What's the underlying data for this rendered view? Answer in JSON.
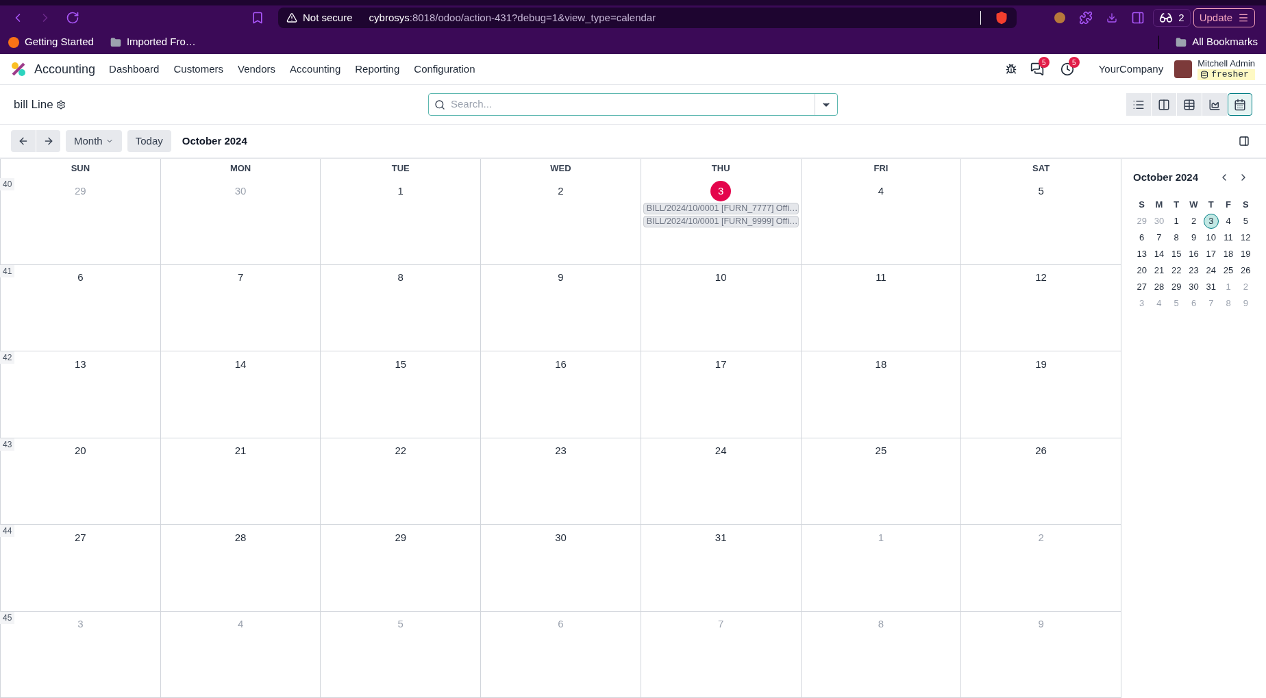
{
  "browser": {
    "security": "Not secure",
    "url_host": "cybrosys",
    "url_path": ":8018/odoo/action-431?debug=1&view_type=calendar",
    "profile_count": "2",
    "update": "Update",
    "bookmarks": [
      {
        "label": "Getting Started",
        "kind": "site"
      },
      {
        "label": "Imported Fro…",
        "kind": "folder"
      }
    ],
    "all_bookmarks": "All Bookmarks"
  },
  "navbar": {
    "app": "Accounting",
    "menu": [
      "Dashboard",
      "Customers",
      "Vendors",
      "Accounting",
      "Reporting",
      "Configuration"
    ],
    "messages_badge": "5",
    "activities_badge": "5",
    "company": "YourCompany",
    "user": "Mitchell Admin",
    "database": "fresher"
  },
  "control_panel": {
    "breadcrumb": "bill Line",
    "search_placeholder": "Search...",
    "views": [
      {
        "kind": "list",
        "selected": false
      },
      {
        "kind": "kanban",
        "selected": false
      },
      {
        "kind": "pivot",
        "selected": false
      },
      {
        "kind": "graph",
        "selected": false
      },
      {
        "kind": "calendar",
        "selected": true
      }
    ]
  },
  "toolbar": {
    "scale": "Month",
    "today": "Today",
    "title": "October 2024"
  },
  "calendar": {
    "weekdays": [
      "SUN",
      "MON",
      "TUE",
      "WED",
      "THU",
      "FRI",
      "SAT"
    ],
    "weeks": [
      {
        "number": "40",
        "days": [
          {
            "label": "29",
            "outside": true,
            "today": false
          },
          {
            "label": "30",
            "outside": true,
            "today": false
          },
          {
            "label": "1",
            "outside": false,
            "today": false
          },
          {
            "label": "2",
            "outside": false,
            "today": false
          },
          {
            "label": "3",
            "outside": false,
            "today": true,
            "events": [
              "BILL/2024/10/0001 [FURN_7777] Offi…",
              "BILL/2024/10/0001 [FURN_9999] Offi…"
            ]
          },
          {
            "label": "4",
            "outside": false,
            "today": false
          },
          {
            "label": "5",
            "outside": false,
            "today": false
          }
        ]
      },
      {
        "number": "41",
        "days": [
          {
            "label": "6",
            "outside": false,
            "today": false
          },
          {
            "label": "7",
            "outside": false,
            "today": false
          },
          {
            "label": "8",
            "outside": false,
            "today": false
          },
          {
            "label": "9",
            "outside": false,
            "today": false
          },
          {
            "label": "10",
            "outside": false,
            "today": false
          },
          {
            "label": "11",
            "outside": false,
            "today": false
          },
          {
            "label": "12",
            "outside": false,
            "today": false
          }
        ]
      },
      {
        "number": "42",
        "days": [
          {
            "label": "13",
            "outside": false,
            "today": false
          },
          {
            "label": "14",
            "outside": false,
            "today": false
          },
          {
            "label": "15",
            "outside": false,
            "today": false
          },
          {
            "label": "16",
            "outside": false,
            "today": false
          },
          {
            "label": "17",
            "outside": false,
            "today": false
          },
          {
            "label": "18",
            "outside": false,
            "today": false
          },
          {
            "label": "19",
            "outside": false,
            "today": false
          }
        ]
      },
      {
        "number": "43",
        "days": [
          {
            "label": "20",
            "outside": false,
            "today": false
          },
          {
            "label": "21",
            "outside": false,
            "today": false
          },
          {
            "label": "22",
            "outside": false,
            "today": false
          },
          {
            "label": "23",
            "outside": false,
            "today": false
          },
          {
            "label": "24",
            "outside": false,
            "today": false
          },
          {
            "label": "25",
            "outside": false,
            "today": false
          },
          {
            "label": "26",
            "outside": false,
            "today": false
          }
        ]
      },
      {
        "number": "44",
        "days": [
          {
            "label": "27",
            "outside": false,
            "today": false
          },
          {
            "label": "28",
            "outside": false,
            "today": false
          },
          {
            "label": "29",
            "outside": false,
            "today": false
          },
          {
            "label": "30",
            "outside": false,
            "today": false
          },
          {
            "label": "31",
            "outside": false,
            "today": false
          },
          {
            "label": "1",
            "outside": true,
            "today": false
          },
          {
            "label": "2",
            "outside": true,
            "today": false
          }
        ]
      },
      {
        "number": "45",
        "days": [
          {
            "label": "3",
            "outside": true,
            "today": false
          },
          {
            "label": "4",
            "outside": true,
            "today": false
          },
          {
            "label": "5",
            "outside": true,
            "today": false
          },
          {
            "label": "6",
            "outside": true,
            "today": false
          },
          {
            "label": "7",
            "outside": true,
            "today": false
          },
          {
            "label": "8",
            "outside": true,
            "today": false
          },
          {
            "label": "9",
            "outside": true,
            "today": false
          }
        ]
      }
    ]
  },
  "mini_calendar": {
    "title": "October 2024",
    "weekdays": [
      "S",
      "M",
      "T",
      "W",
      "T",
      "F",
      "S"
    ],
    "weeks": [
      [
        {
          "label": "29",
          "outside": true,
          "selected": false
        },
        {
          "label": "30",
          "outside": true,
          "selected": false
        },
        {
          "label": "1",
          "outside": false,
          "selected": false
        },
        {
          "label": "2",
          "outside": false,
          "selected": false
        },
        {
          "label": "3",
          "outside": false,
          "selected": true
        },
        {
          "label": "4",
          "outside": false,
          "selected": false
        },
        {
          "label": "5",
          "outside": false,
          "selected": false
        }
      ],
      [
        {
          "label": "6",
          "outside": false,
          "selected": false
        },
        {
          "label": "7",
          "outside": false,
          "selected": false
        },
        {
          "label": "8",
          "outside": false,
          "selected": false
        },
        {
          "label": "9",
          "outside": false,
          "selected": false
        },
        {
          "label": "10",
          "outside": false,
          "selected": false
        },
        {
          "label": "11",
          "outside": false,
          "selected": false
        },
        {
          "label": "12",
          "outside": false,
          "selected": false
        }
      ],
      [
        {
          "label": "13",
          "outside": false,
          "selected": false
        },
        {
          "label": "14",
          "outside": false,
          "selected": false
        },
        {
          "label": "15",
          "outside": false,
          "selected": false
        },
        {
          "label": "16",
          "outside": false,
          "selected": false
        },
        {
          "label": "17",
          "outside": false,
          "selected": false
        },
        {
          "label": "18",
          "outside": false,
          "selected": false
        },
        {
          "label": "19",
          "outside": false,
          "selected": false
        }
      ],
      [
        {
          "label": "20",
          "outside": false,
          "selected": false
        },
        {
          "label": "21",
          "outside": false,
          "selected": false
        },
        {
          "label": "22",
          "outside": false,
          "selected": false
        },
        {
          "label": "23",
          "outside": false,
          "selected": false
        },
        {
          "label": "24",
          "outside": false,
          "selected": false
        },
        {
          "label": "25",
          "outside": false,
          "selected": false
        },
        {
          "label": "26",
          "outside": false,
          "selected": false
        }
      ],
      [
        {
          "label": "27",
          "outside": false,
          "selected": false
        },
        {
          "label": "28",
          "outside": false,
          "selected": false
        },
        {
          "label": "29",
          "outside": false,
          "selected": false
        },
        {
          "label": "30",
          "outside": false,
          "selected": false
        },
        {
          "label": "31",
          "outside": false,
          "selected": false
        },
        {
          "label": "1",
          "outside": true,
          "selected": false
        },
        {
          "label": "2",
          "outside": true,
          "selected": false
        }
      ],
      [
        {
          "label": "3",
          "outside": true,
          "selected": false
        },
        {
          "label": "4",
          "outside": true,
          "selected": false
        },
        {
          "label": "5",
          "outside": true,
          "selected": false
        },
        {
          "label": "6",
          "outside": true,
          "selected": false
        },
        {
          "label": "7",
          "outside": true,
          "selected": false
        },
        {
          "label": "8",
          "outside": true,
          "selected": false
        },
        {
          "label": "9",
          "outside": true,
          "selected": false
        }
      ]
    ]
  }
}
